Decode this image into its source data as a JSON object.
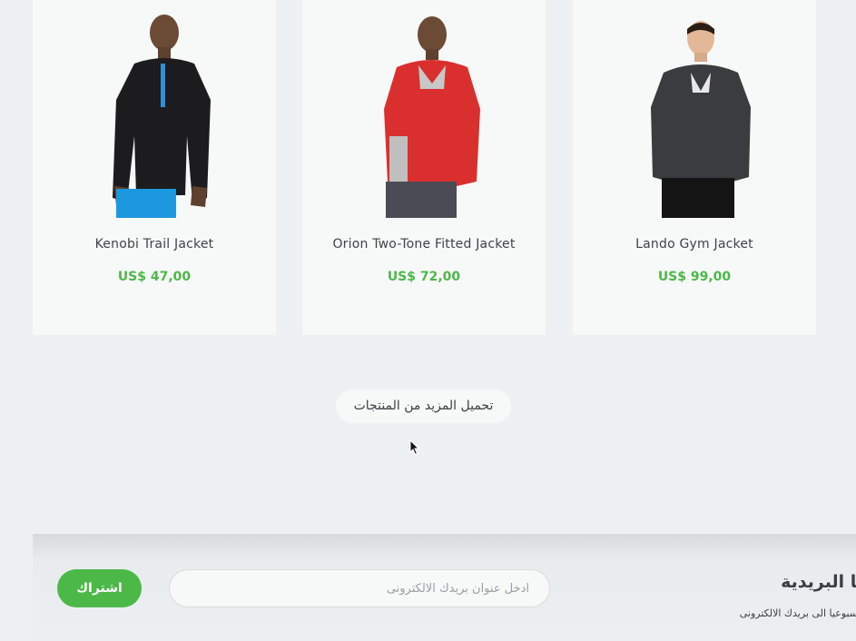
{
  "products": [
    {
      "name": "Kenobi Trail Jacket",
      "price": "US$ 47,00",
      "image": "black-zip-jacket-model"
    },
    {
      "name": "Orion Two-Tone Fitted Jacket",
      "price": "US$ 72,00",
      "image": "red-fleece-jacket-model"
    },
    {
      "name": "Lando Gym Jacket",
      "price": "US$ 99,00",
      "image": "charcoal-fleece-jacket-model"
    }
  ],
  "load_more": {
    "label": "تحميل المزيد من المنتجات"
  },
  "newsletter": {
    "title": "نا البريدية",
    "description": "سبوعيا الى بريدك الالكترونى",
    "email_placeholder": "ادخل عنوان بريدك الالكترونى",
    "email_value": "",
    "subscribe_label": "اشتراك"
  },
  "colors": {
    "accent": "#4cb848",
    "card_bg": "#f7f8f8",
    "page_bg": "#eef1f3",
    "text": "#3a3f44"
  }
}
